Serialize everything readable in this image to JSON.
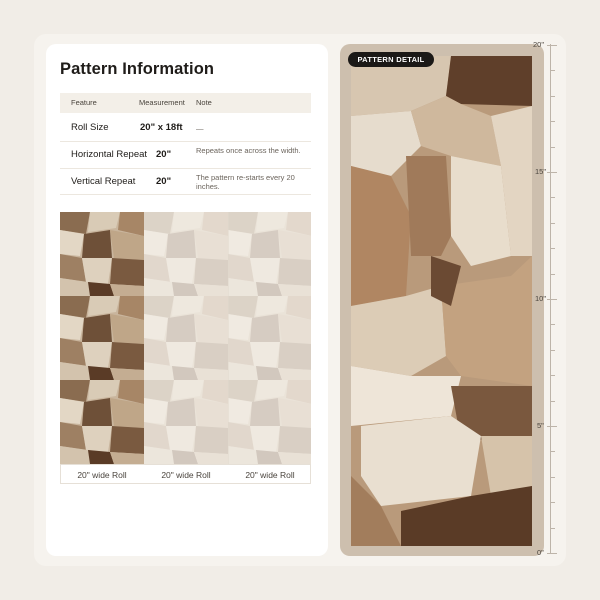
{
  "title": "Pattern Information",
  "table": {
    "headers": [
      "Feature",
      "Measurement",
      "Note"
    ],
    "rows": [
      {
        "feature": "Roll Size",
        "measurement": "20\" x 18ft",
        "note": "—"
      },
      {
        "feature": "Horizontal Repeat",
        "measurement": "20\"",
        "note": "Repeats once across the width."
      },
      {
        "feature": "Vertical Repeat",
        "measurement": "20\"",
        "note": "The pattern re-starts every 20 inches."
      }
    ]
  },
  "rolls": [
    "20\" wide Roll",
    "20\" wide Roll",
    "20\" wide Roll"
  ],
  "detail": {
    "badge": "PATTERN DETAIL"
  },
  "ruler": {
    "labels": [
      "20\"",
      "15\"",
      "10\"",
      "5\"",
      "0\""
    ]
  },
  "colors": {
    "background": "#f1ede7",
    "card": "#ffffff",
    "badge": "#1b1917",
    "pattern_dark": "#5a3b26",
    "pattern_light": "#e6dccd"
  }
}
